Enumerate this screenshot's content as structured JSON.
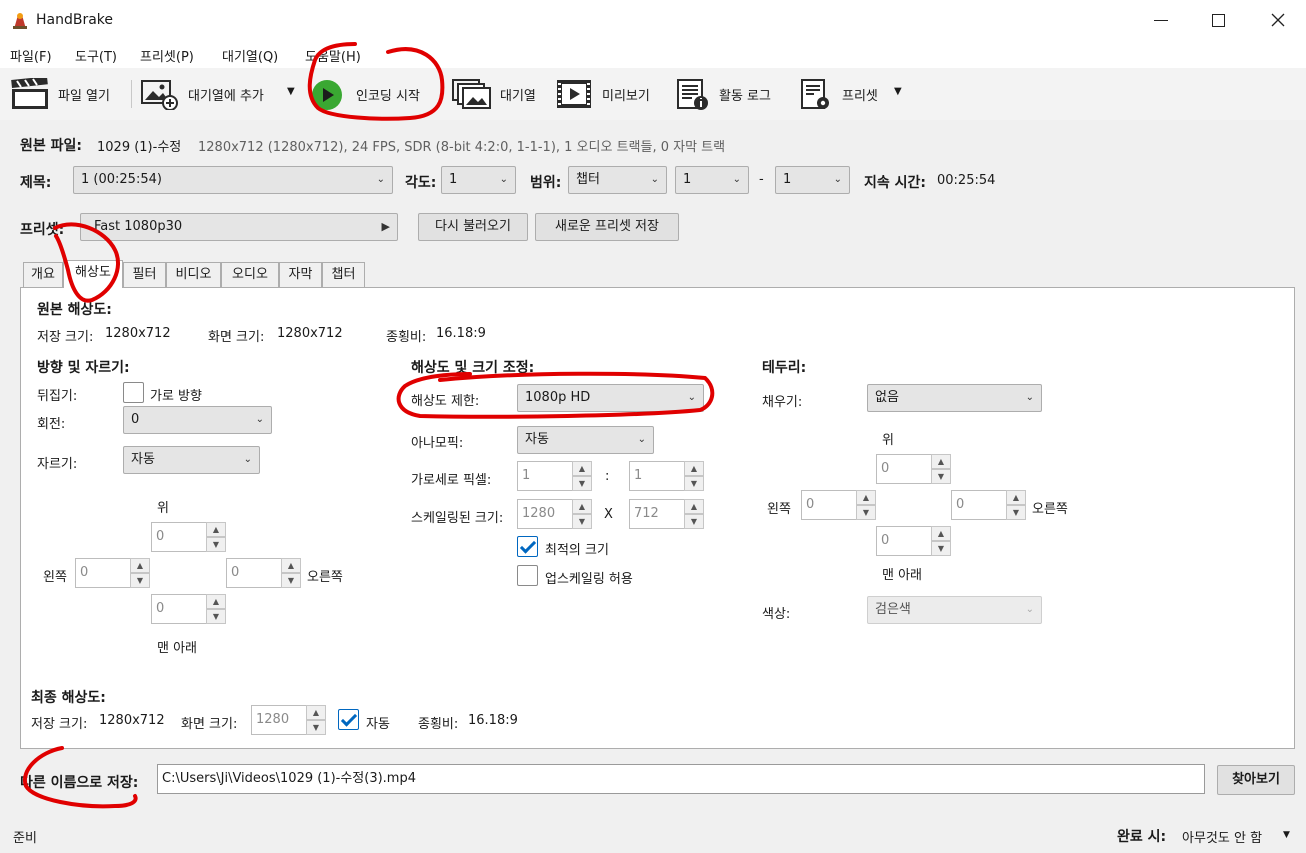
{
  "window": {
    "title": "HandBrake"
  },
  "menu": [
    "파일(F)",
    "도구(T)",
    "프리셋(P)",
    "대기열(Q)",
    "도움말(H)"
  ],
  "toolbar": {
    "open": "파일 열기",
    "add_queue": "대기열에 추가",
    "start": "인코딩 시작",
    "queue": "대기열",
    "preview": "미리보기",
    "log": "활동 로그",
    "presets": "프리셋"
  },
  "source": {
    "label": "원본 파일:",
    "name": "1029 (1)-수정",
    "info": "1280x712 (1280x712), 24 FPS, SDR (8-bit 4:2:0, 1-1-1), 1 오디오 트랙들, 0 자막 트랙"
  },
  "title_row": {
    "title_label": "제목:",
    "title_value": "1  (00:25:54)",
    "angle_label": "각도:",
    "angle_value": "1",
    "range_label": "범위:",
    "range_type": "챕터",
    "range_from": "1",
    "dash": "-",
    "range_to": "1",
    "duration_label": "지속 시간:",
    "duration_value": "00:25:54"
  },
  "preset_row": {
    "label": "프리셋:",
    "value": "Fast 1080p30",
    "reload": "다시 불러오기",
    "save_new": "새로운 프리셋 저장"
  },
  "tabs": [
    "개요",
    "해상도",
    "필터",
    "비디오",
    "오디오",
    "자막",
    "챕터"
  ],
  "dimensions": {
    "source_header": "원본 해상도:",
    "storage_label": "저장 크기:",
    "storage_value": "1280x712",
    "display_label": "화면 크기:",
    "display_value": "1280x712",
    "aspect_label": "종횡비:",
    "aspect_value": "16.18:9",
    "orient_header": "방향 및 자르기:",
    "flip_label": "뒤집기:",
    "flip_option": "가로 방향",
    "rotate_label": "회전:",
    "rotate_value": "0",
    "crop_label": "자르기:",
    "crop_value": "자동",
    "top": "위",
    "left": "왼쪽",
    "right": "오른쪽",
    "bottom": "맨 아래",
    "crop_top": "0",
    "crop_left": "0",
    "crop_right": "0",
    "crop_bottom": "0",
    "res_header": "해상도 및 크기 조정:",
    "res_limit_label": "해상도 제한:",
    "res_limit_value": "1080p HD",
    "anamorphic_label": "아나모픽:",
    "anamorphic_value": "자동",
    "par_label": "가로세로 픽셀:",
    "par_w": "1",
    "par_sep": ":",
    "par_h": "1",
    "scaled_label": "스케일링된 크기:",
    "scaled_w": "1280",
    "scaled_sep": "X",
    "scaled_h": "712",
    "optimal": "최적의 크기",
    "upscale": "업스케일링 허용",
    "border_header": "테두리:",
    "fill_label": "채우기:",
    "fill_value": "없음",
    "pad_top": "0",
    "pad_left": "0",
    "pad_right": "0",
    "pad_bottom": "0",
    "color_label": "색상:",
    "color_value": "검은색",
    "final_header": "최종 해상도:",
    "final_storage_label": "저장 크기:",
    "final_storage_value": "1280x712",
    "final_display_label": "화면 크기:",
    "final_display_value": "1280",
    "final_auto": "자동",
    "final_aspect_label": "종횡비:",
    "final_aspect_value": "16.18:9"
  },
  "save": {
    "label": "다른 이름으로 저장:",
    "path": "C:\\Users\\Ji\\Videos\\1029 (1)-수정(3).mp4",
    "browse": "찾아보기"
  },
  "status": {
    "text": "준비",
    "done_label": "완료 시:",
    "done_value": "아무것도 안 함"
  },
  "colors": {
    "accent": "#0067c0",
    "annotation": "#e00000",
    "play": "#3aa832"
  }
}
